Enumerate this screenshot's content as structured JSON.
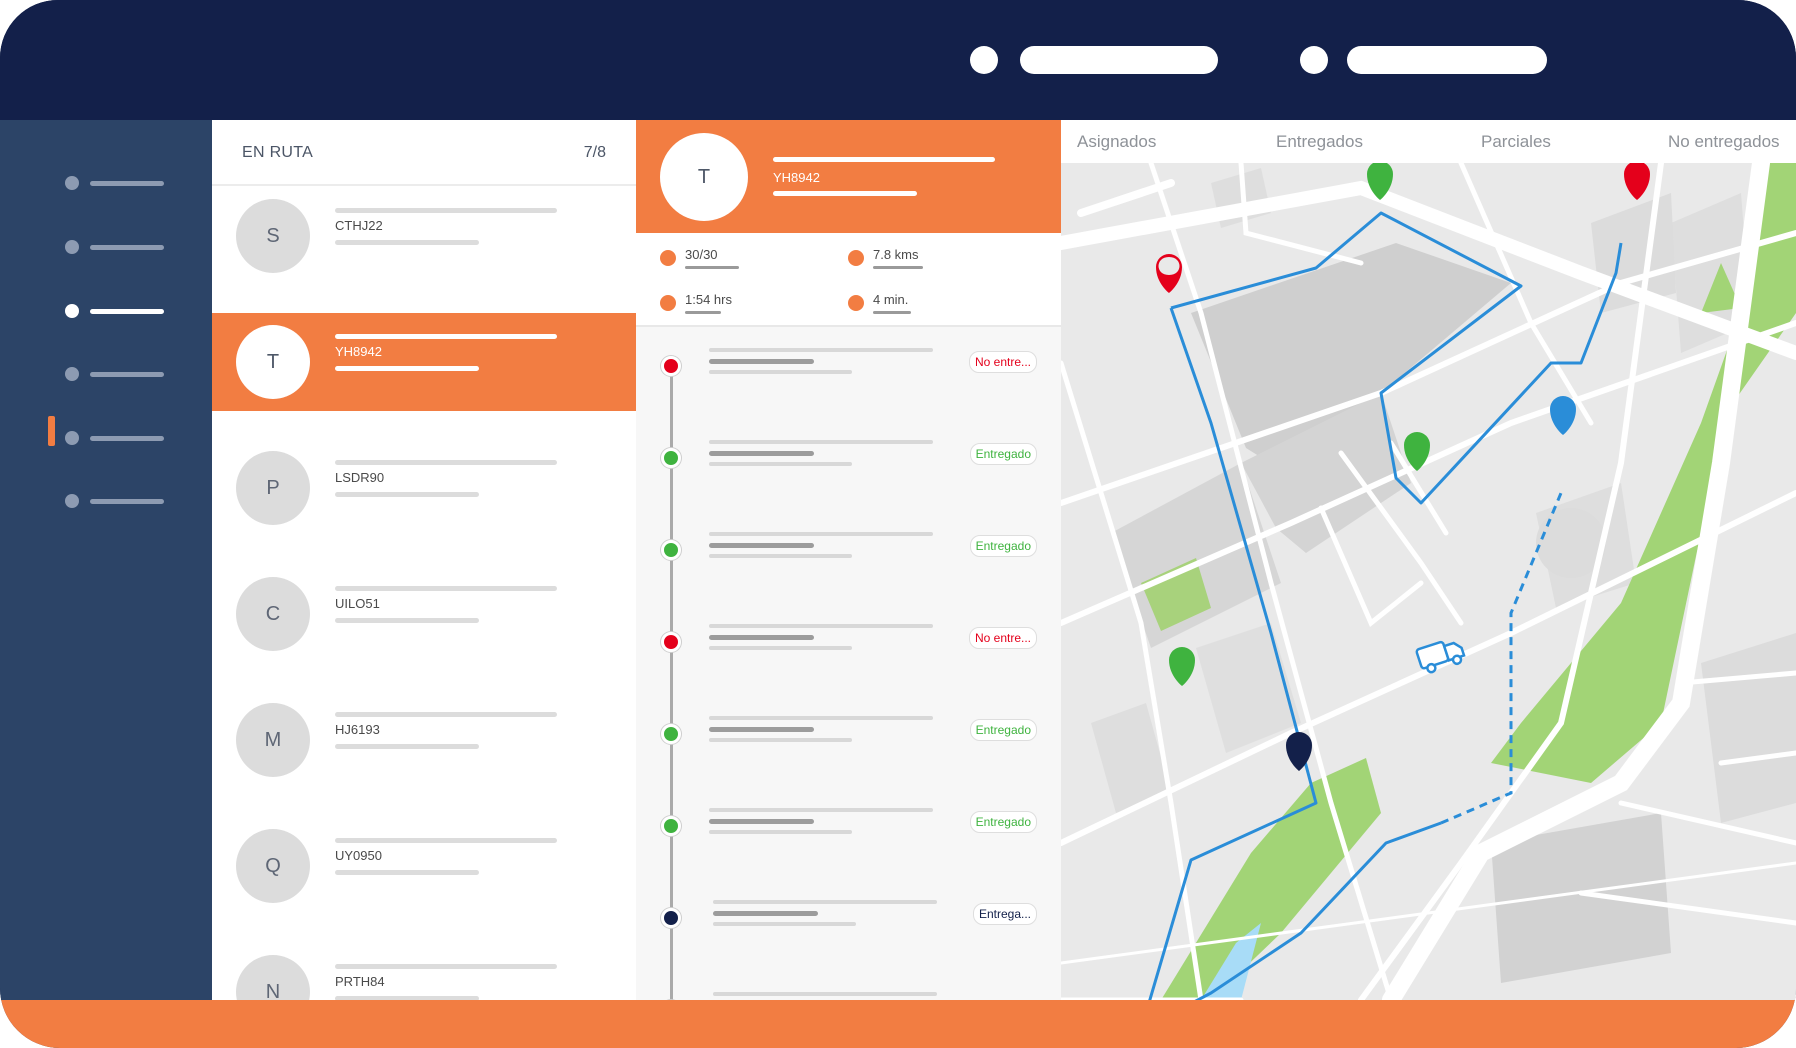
{
  "colors": {
    "navy": "#13204a",
    "sidebar": "#2c4467",
    "accent": "#f27d42",
    "delivered": "#3fb33f",
    "not_delivered": "#e4001b",
    "in_progress": "#13204a",
    "route_line": "#2a8dd8"
  },
  "routes_panel": {
    "title": "EN RUTA",
    "count": "7/8",
    "routes": [
      {
        "initial": "S",
        "code": "CTHJ22",
        "selected": false
      },
      {
        "initial": "T",
        "code": "YH8942",
        "selected": true
      },
      {
        "initial": "P",
        "code": "LSDR90",
        "selected": false
      },
      {
        "initial": "C",
        "code": "UILO51",
        "selected": false
      },
      {
        "initial": "M",
        "code": "HJ6193",
        "selected": false
      },
      {
        "initial": "Q",
        "code": "UY0950",
        "selected": false
      },
      {
        "initial": "N",
        "code": "PRTH84",
        "selected": false
      }
    ]
  },
  "detail": {
    "initial": "T",
    "code": "YH8942",
    "stats": {
      "deliveries": "30/30",
      "distance": "7.8 kms",
      "duration": "1:54 hrs",
      "avg_time": "4 min."
    },
    "stops": [
      {
        "status": "No entre...",
        "state": "not_delivered"
      },
      {
        "status": "Entregado",
        "state": "delivered"
      },
      {
        "status": "Entregado",
        "state": "delivered"
      },
      {
        "status": "No entre...",
        "state": "not_delivered"
      },
      {
        "status": "Entregado",
        "state": "delivered"
      },
      {
        "status": "Entregado",
        "state": "delivered"
      },
      {
        "status": "Entrega...",
        "state": "in_progress"
      },
      {
        "status": "",
        "state": "pending"
      }
    ]
  },
  "map": {
    "tabs": [
      "Asignados",
      "Entregados",
      "Parciales",
      "No entregados"
    ],
    "icons": [
      "map-pin-icon",
      "delivery-truck-icon"
    ]
  }
}
